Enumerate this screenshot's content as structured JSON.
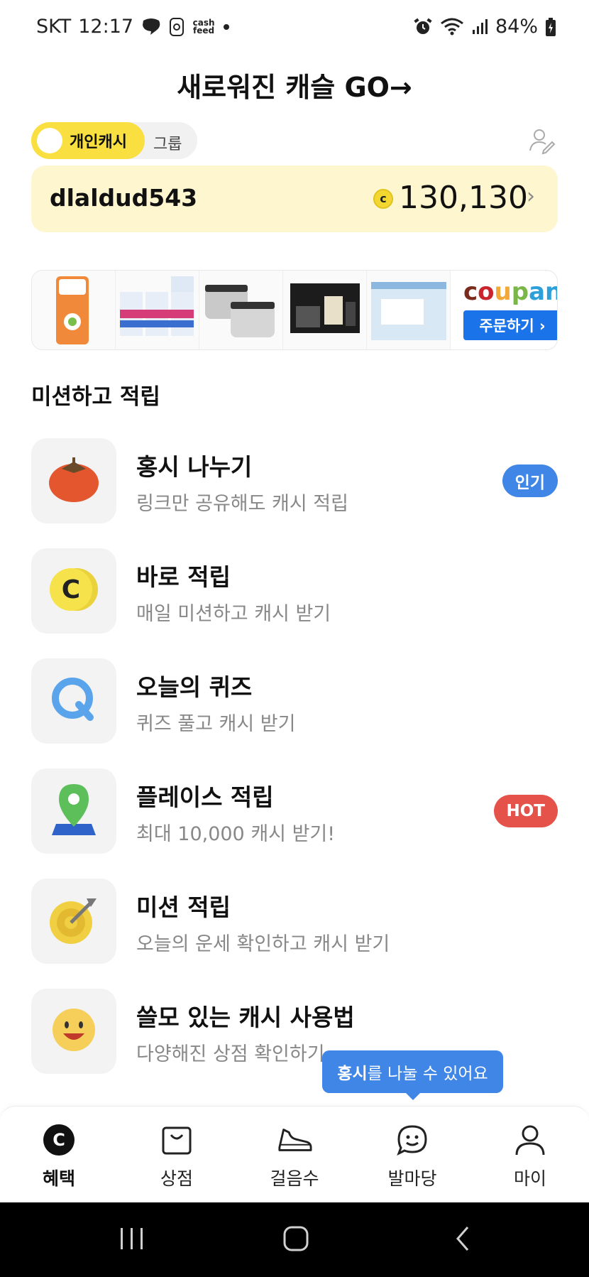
{
  "status_bar": {
    "carrier": "SKT",
    "time": "12:17",
    "notif_cash_feed": "cash feed",
    "battery": "84%",
    "left_icons": [
      "chat-bubble-icon",
      "app-notification-icon",
      "cash-feed-icon",
      "dot-icon"
    ],
    "right_icons": [
      "alarm-icon",
      "wifi-icon",
      "signal-icon",
      "battery-icon"
    ]
  },
  "promo": {
    "title": "새로워진 캐슬   GO→"
  },
  "account_toggle": {
    "personal_label": "개인캐시",
    "group_label": "그룹",
    "active": "personal"
  },
  "cash_card": {
    "username": "dlaldud543",
    "coin_symbol": "c",
    "amount": "130,130",
    "chevron": "›"
  },
  "ad_banner": {
    "brand": "coupang",
    "cta": "주문하기 ›",
    "products": [
      "wet-tissue-pack",
      "detergent-boxes",
      "steel-containers",
      "gift-set",
      "mask-box"
    ]
  },
  "missions": {
    "section_title": "미션하고 적립",
    "items": [
      {
        "title": "홍시 나누기",
        "desc": "링크만 공유해도 캐시 적립",
        "icon": "persimmon-icon",
        "badge": "인기",
        "badge_color": "#3f86e6"
      },
      {
        "title": "바로 적립",
        "desc": "매일 미션하고 캐시 받기",
        "icon": "coin-icon",
        "badge": "",
        "badge_color": ""
      },
      {
        "title": "오늘의 퀴즈",
        "desc": "퀴즈 풀고 캐시 받기",
        "icon": "quiz-q-icon",
        "badge": "",
        "badge_color": ""
      },
      {
        "title": "플레이스 적립",
        "desc": "최대 10,000 캐시 받기!",
        "icon": "map-pin-icon",
        "badge": "HOT",
        "badge_color": "#e4524a"
      },
      {
        "title": "미션 적립",
        "desc": "오늘의 운세 확인하고 캐시 받기",
        "icon": "target-icon",
        "badge": "",
        "badge_color": ""
      },
      {
        "title": "쓸모 있는 캐시 사용법",
        "desc": "다양해진 상점 확인하기",
        "icon": "smiley-icon",
        "badge": "",
        "badge_color": ""
      }
    ]
  },
  "tooltip": {
    "bold": "홍시",
    "text": "를 나눌 수 있어요"
  },
  "bottom_nav": {
    "items": [
      {
        "label": "혜택",
        "icon": "cash-c-icon",
        "active": true
      },
      {
        "label": "상점",
        "icon": "shopping-bag-icon",
        "active": false
      },
      {
        "label": "걸음수",
        "icon": "sneaker-icon",
        "active": false
      },
      {
        "label": "발마당",
        "icon": "chat-smile-icon",
        "active": false
      },
      {
        "label": "마이",
        "icon": "person-icon",
        "active": false
      }
    ]
  },
  "system_nav": {
    "buttons": [
      "recent-apps-icon",
      "home-icon",
      "back-icon"
    ]
  },
  "colors": {
    "accent_yellow": "#f9df3f",
    "card_bg": "#fdf6cf",
    "badge_blue": "#3f86e6",
    "badge_red": "#e4524a",
    "coupang_blue": "#1a73e8"
  }
}
